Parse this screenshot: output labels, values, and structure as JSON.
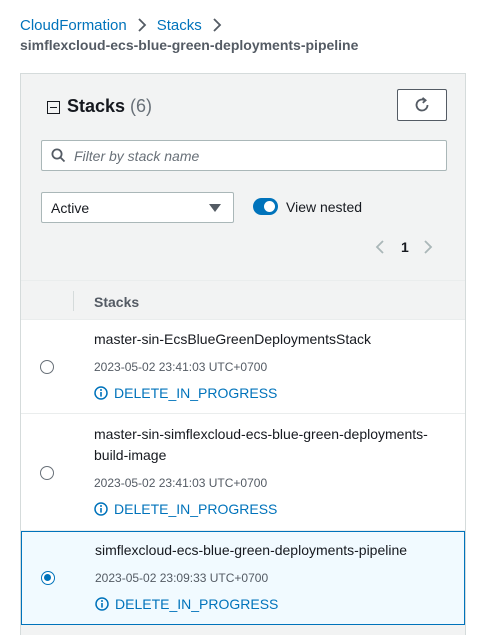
{
  "breadcrumb": {
    "items": [
      "CloudFormation",
      "Stacks"
    ]
  },
  "page_title": "simflexcloud-ecs-blue-green-deployments-pipeline",
  "panel": {
    "title": "Stacks",
    "count": "(6)",
    "search_placeholder": "Filter by stack name",
    "filter_value": "Active",
    "view_nested_label": "View nested",
    "view_nested_on": true,
    "page": "1"
  },
  "table": {
    "column_header": "Stacks",
    "rows": [
      {
        "name": "master-sin-EcsBlueGreenDeploymentsStack",
        "time": "2023-05-02 23:41:03 UTC+0700",
        "status": "DELETE_IN_PROGRESS",
        "selected": false
      },
      {
        "name": "master-sin-simflexcloud-ecs-blue-green-deployments-build-image",
        "time": "2023-05-02 23:41:03 UTC+0700",
        "status": "DELETE_IN_PROGRESS",
        "selected": false
      },
      {
        "name": "simflexcloud-ecs-blue-green-deployments-pipeline",
        "time": "2023-05-02 23:09:33 UTC+0700",
        "status": "DELETE_IN_PROGRESS",
        "selected": true
      }
    ]
  },
  "colors": {
    "link": "#0073bb",
    "selected_bg": "#f1faff",
    "panel_bg": "#f2f3f3"
  },
  "icons": [
    "chevron-right-icon",
    "collapse-icon",
    "refresh-icon",
    "search-icon",
    "caret-down-icon",
    "chevron-left-icon",
    "info-icon"
  ]
}
